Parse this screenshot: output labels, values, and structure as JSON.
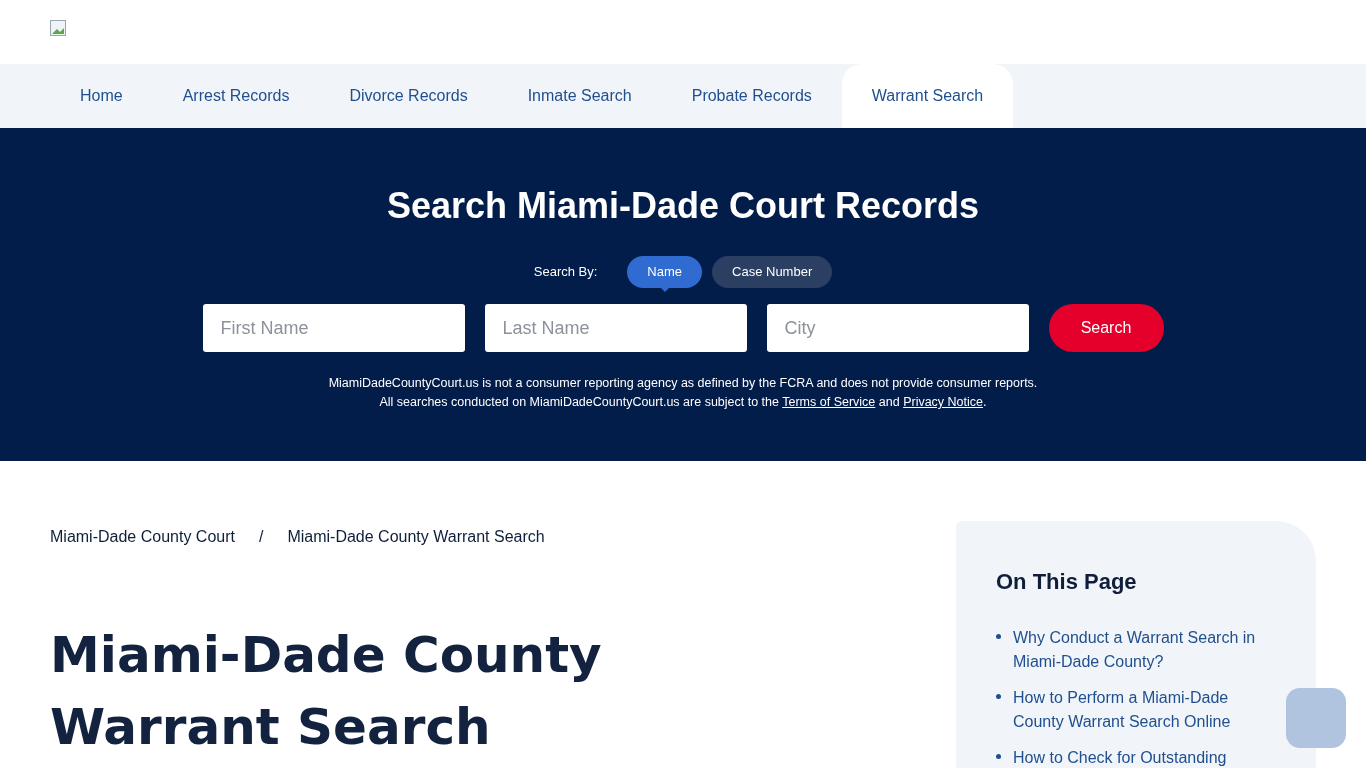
{
  "nav": [
    {
      "label": "Home",
      "selected": false
    },
    {
      "label": "Arrest Records",
      "selected": false
    },
    {
      "label": "Divorce Records",
      "selected": false
    },
    {
      "label": "Inmate Search",
      "selected": false
    },
    {
      "label": "Probate Records",
      "selected": false
    },
    {
      "label": "Warrant Search",
      "selected": true
    }
  ],
  "hero": {
    "title": "Search Miami-Dade Court Records",
    "search_by_label": "Search By:",
    "search_by": [
      {
        "label": "Name",
        "selected": true
      },
      {
        "label": "Case Number",
        "selected": false
      }
    ],
    "fields": [
      {
        "placeholder": "First Name"
      },
      {
        "placeholder": "Last Name"
      },
      {
        "placeholder": "City"
      }
    ],
    "search_button": "Search",
    "disclaimer_line_1": "MiamiDadeCountyCourt.us is not a consumer reporting agency as defined by the FCRA and does not provide consumer reports.",
    "disclaimer_line_2": {
      "before": "All searches conducted on MiamiDadeCountyCourt.us are subject to the",
      "link_1": "Terms of Service",
      "between": "and",
      "link_2": "Privacy Notice",
      "after": "."
    }
  },
  "breadcrumb": [
    {
      "label": "Miami-Dade County Court"
    },
    {
      "label": "Miami-Dade County Warrant Search"
    }
  ],
  "breadcrumb_separator": "/",
  "page_title": "Miami-Dade County Warrant Search",
  "toc": {
    "title": "On This Page",
    "items": [
      "Why Conduct a Warrant Search in Miami-Dade County?",
      "How to Perform a Miami-Dade County Warrant Search Online",
      "How to Check for Outstanding"
    ]
  }
}
